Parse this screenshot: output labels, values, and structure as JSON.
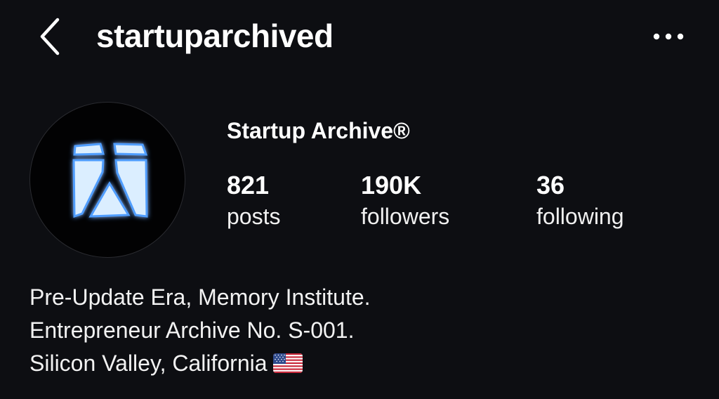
{
  "header": {
    "back_icon": "chevron-left-icon",
    "username": "startuparchived",
    "more_icon": "more-horizontal-icon"
  },
  "profile": {
    "avatar_icon": "startup-archive-logo",
    "display_name": "Startup Archive®",
    "stats": {
      "posts": {
        "value": "821",
        "label": "posts"
      },
      "followers": {
        "value": "190K",
        "label": "followers"
      },
      "following": {
        "value": "36",
        "label": "following"
      }
    },
    "bio": {
      "line1": "Pre-Update Era, Memory Institute.",
      "line2": "Entrepreneur Archive No. S-001.",
      "line3": "Silicon Valley, California",
      "flag_icon": "us-flag-icon"
    }
  },
  "colors": {
    "background": "#0d0e12",
    "text": "#ffffff",
    "logo_glow": "#5aa8ff",
    "logo_core": "#e8f4ff"
  }
}
